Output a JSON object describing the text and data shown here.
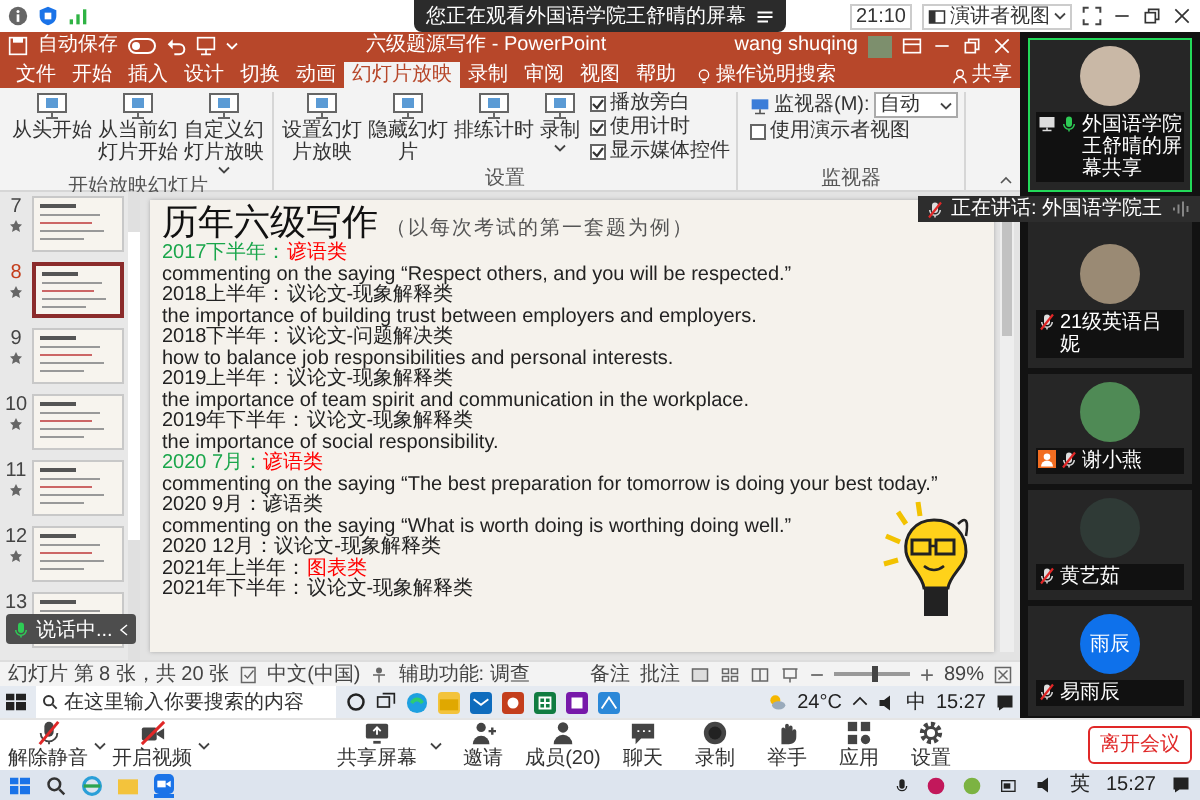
{
  "meeting_header": {
    "viewing_banner": "您正在观看外国语学院王舒晴的屏幕",
    "timer": "21:10",
    "view_button": "演讲者视图"
  },
  "powerpoint": {
    "autosave": {
      "label": "自动保存",
      "on": false
    },
    "title": "六级题源写作 - PowerPoint",
    "user": "wang shuqing",
    "tabs": [
      {
        "label": "文件",
        "selected": false
      },
      {
        "label": "开始",
        "selected": false
      },
      {
        "label": "插入",
        "selected": false
      },
      {
        "label": "设计",
        "selected": false
      },
      {
        "label": "切换",
        "selected": false
      },
      {
        "label": "动画",
        "selected": false
      },
      {
        "label": "幻灯片放映",
        "selected": true
      },
      {
        "label": "录制",
        "selected": false
      },
      {
        "label": "审阅",
        "selected": false
      },
      {
        "label": "视图",
        "selected": false
      },
      {
        "label": "帮助",
        "selected": false
      }
    ],
    "tell_me": "操作说明搜索",
    "share": "共享",
    "ribbon_groups": [
      {
        "label": "开始放映幻灯片",
        "items": [
          {
            "kind": "button",
            "label": "从头开始"
          },
          {
            "kind": "button",
            "label": "从当前幻灯片开始"
          },
          {
            "kind": "dropdown",
            "label": "自定义幻灯片放映"
          }
        ]
      },
      {
        "label": "设置",
        "items": [
          {
            "kind": "button",
            "label": "设置幻灯片放映"
          },
          {
            "kind": "button",
            "label": "隐藏幻灯片"
          },
          {
            "kind": "button",
            "label": "排练计时"
          },
          {
            "kind": "dropdown",
            "label": "录制"
          },
          {
            "kind": "checkbox",
            "label": "播放旁白",
            "checked": true
          },
          {
            "kind": "checkbox",
            "label": "使用计时",
            "checked": true
          },
          {
            "kind": "checkbox",
            "label": "显示媒体控件",
            "checked": true
          }
        ]
      },
      {
        "label": "监视器",
        "items": [
          {
            "kind": "select",
            "label": "监视器(M):",
            "value": "自动"
          },
          {
            "kind": "checkbox",
            "label": "使用演示者视图",
            "checked": false
          }
        ]
      }
    ],
    "thumbnails": [
      {
        "number": "7",
        "selected": false
      },
      {
        "number": "8",
        "selected": true
      },
      {
        "number": "9",
        "selected": false
      },
      {
        "number": "10",
        "selected": false
      },
      {
        "number": "11",
        "selected": false
      },
      {
        "number": "12",
        "selected": false
      },
      {
        "number": "13",
        "selected": false
      }
    ],
    "slide": {
      "title": "历年六级写作",
      "subtitle": "（以每次考试的第一套题为例）",
      "lines": [
        {
          "kind": "topic",
          "date": {
            "text": "2017下半年：",
            "color": "#1aa64b"
          },
          "category": {
            "text": "谚语类",
            "color": "#ff0000"
          }
        },
        {
          "kind": "prompt",
          "text": "commenting on the saying “Respect others, and you will be respected.”"
        },
        {
          "kind": "topic",
          "date": {
            "text": "2018上半年：",
            "color": "#222222"
          },
          "category": {
            "text": "议论文-现象解释类",
            "color": "#222222"
          }
        },
        {
          "kind": "prompt",
          "text": "the importance of building trust between employers and employers."
        },
        {
          "kind": "topic",
          "date": {
            "text": "2018下半年：",
            "color": "#222222"
          },
          "category": {
            "text": "议论文-问题解决类",
            "color": "#222222"
          }
        },
        {
          "kind": "prompt",
          "text": "how to balance job responsibilities and personal interests."
        },
        {
          "kind": "topic",
          "date": {
            "text": "2019上半年：",
            "color": "#222222"
          },
          "category": {
            "text": "议论文-现象解释类",
            "color": "#222222"
          }
        },
        {
          "kind": "prompt",
          "text": "the importance of team spirit and communication in the workplace."
        },
        {
          "kind": "topic",
          "date": {
            "text": "2019年下半年：",
            "color": "#222222"
          },
          "category": {
            "text": "议论文-现象解释类",
            "color": "#222222"
          }
        },
        {
          "kind": "prompt",
          "text": "the importance of social responsibility."
        },
        {
          "kind": "topic",
          "date": {
            "text": "2020 7月：",
            "color": "#1aa64b"
          },
          "category": {
            "text": "谚语类",
            "color": "#ff0000"
          }
        },
        {
          "kind": "prompt",
          "text": "commenting on the saying “The best preparation for tomorrow is doing your best today.”"
        },
        {
          "kind": "topic",
          "date": {
            "text": "2020 9月：",
            "color": "#222222"
          },
          "category": {
            "text": "谚语类",
            "color": "#222222"
          }
        },
        {
          "kind": "prompt",
          "text": "commenting on the saying “What is worth doing is worthing doing well.”"
        },
        {
          "kind": "topic",
          "date": {
            "text": "2020 12月：",
            "color": "#222222"
          },
          "category": {
            "text": "议论文-现象解释类",
            "color": "#222222"
          }
        },
        {
          "kind": "topic",
          "date": {
            "text": "2021年上半年：",
            "color": "#222222"
          },
          "category": {
            "text": "图表类",
            "color": "#ff0000"
          }
        },
        {
          "kind": "topic",
          "date": {
            "text": "2021年下半年：",
            "color": "#222222"
          },
          "category": {
            "text": "议论文-现象解释类",
            "color": "#222222"
          }
        }
      ]
    },
    "status_bar": {
      "slide_info": "幻灯片 第 8 张，共 20 张",
      "language": "中文(中国)",
      "accessibility": "辅助功能: 调查",
      "notes": "备注",
      "comments": "批注",
      "zoom": {
        "level": 0.55,
        "reading": "89%"
      }
    }
  },
  "speaking_overlay": "说话中...",
  "speaking_tooltip": "正在讲话: 外国语学院王",
  "shared_taskbar": {
    "search_placeholder": "在这里输入你要搜索的内容",
    "temperature": "24°C",
    "ime": "中",
    "time": "15:27"
  },
  "participants": [
    {
      "name": "外国语学院王舒晴的屏幕共享",
      "kind": "photo",
      "color": "#c9b8a6",
      "speaking": true,
      "muted": false,
      "host": false,
      "sharing": true
    },
    {
      "name": "21级英语吕妮",
      "kind": "photo",
      "color": "#9a8a74",
      "speaking": false,
      "muted": true,
      "host": false,
      "sharing": false
    },
    {
      "name": "谢小燕",
      "kind": "photo",
      "color": "#4f8a55",
      "speaking": false,
      "muted": true,
      "host": true,
      "sharing": false
    },
    {
      "name": "黄艺茹",
      "kind": "photo",
      "color": "#2f3a36",
      "speaking": false,
      "muted": true,
      "host": false,
      "sharing": false
    },
    {
      "name": "易雨辰",
      "kind": "initials",
      "initials": "雨辰",
      "color": "#0e71eb",
      "speaking": false,
      "muted": true,
      "host": false,
      "sharing": false
    }
  ],
  "zoom_toolbar": {
    "left": [
      {
        "kind": "mic",
        "label": "解除静音"
      },
      {
        "kind": "video",
        "label": "开启视频"
      }
    ],
    "center": [
      {
        "kind": "share",
        "label": "共享屏幕"
      },
      {
        "kind": "invite",
        "label": "邀请"
      },
      {
        "kind": "members",
        "label": "成员(20)"
      },
      {
        "kind": "chat",
        "label": "聊天"
      },
      {
        "kind": "record",
        "label": "录制"
      },
      {
        "kind": "hand",
        "label": "举手"
      },
      {
        "kind": "apps",
        "label": "应用"
      },
      {
        "kind": "settings",
        "label": "设置"
      }
    ],
    "leave": "离开会议"
  },
  "system_taskbar": {
    "ime": "英",
    "time": "15:27"
  }
}
